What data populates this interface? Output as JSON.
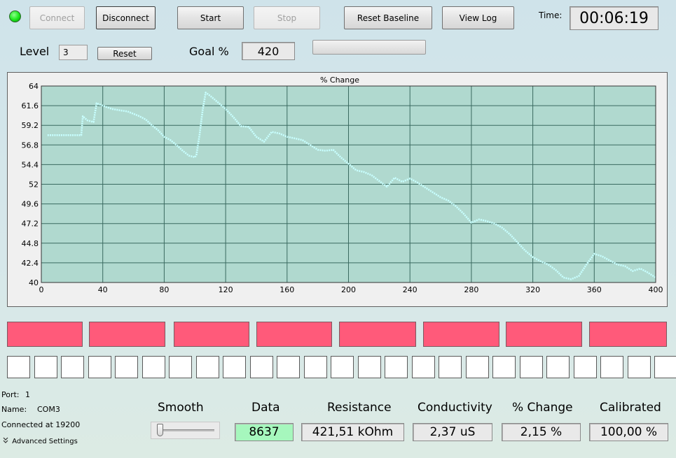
{
  "toolbar": {
    "connect_label": "Connect",
    "disconnect_label": "Disconnect",
    "start_label": "Start",
    "stop_label": "Stop",
    "reset_baseline_label": "Reset Baseline",
    "view_log_label": "View Log",
    "time_label": "Time:",
    "time_value": "00:06:19",
    "status_color": "#19e619"
  },
  "settings": {
    "level_label": "Level",
    "level_value": "3",
    "reset_label": "Reset",
    "goal_label": "Goal %",
    "goal_value": "420",
    "progress": 0
  },
  "chart_data": {
    "type": "line",
    "title": "% Change",
    "xlim": [
      0,
      400
    ],
    "ylim": [
      40,
      64
    ],
    "xticks": [
      0,
      40,
      80,
      120,
      160,
      200,
      240,
      280,
      320,
      360,
      400
    ],
    "yticks": [
      40,
      42.4,
      44.8,
      47.2,
      49.6,
      52,
      54.4,
      56.8,
      59.2,
      61.6,
      64
    ],
    "grid": true,
    "line_color": "#c8ffff",
    "plot_bg": "#b0d9cf",
    "x": [
      4,
      20,
      26,
      27,
      30,
      34,
      36,
      40,
      46,
      52,
      56,
      60,
      64,
      68,
      72,
      76,
      80,
      84,
      88,
      92,
      96,
      100,
      101,
      103,
      105,
      107,
      110,
      115,
      120,
      125,
      130,
      135,
      140,
      145,
      150,
      155,
      160,
      165,
      170,
      175,
      180,
      185,
      190,
      195,
      200,
      205,
      210,
      215,
      220,
      225,
      230,
      235,
      240,
      245,
      250,
      255,
      260,
      265,
      270,
      275,
      280,
      285,
      290,
      295,
      300,
      305,
      310,
      315,
      320,
      325,
      330,
      335,
      340,
      345,
      350,
      355,
      360,
      365,
      370,
      375,
      380,
      385,
      390,
      395,
      400
    ],
    "y": [
      58,
      58,
      58,
      60.3,
      59.8,
      59.6,
      61.9,
      61.6,
      61.2,
      61,
      60.9,
      60.6,
      60.3,
      59.9,
      59.2,
      58.6,
      57.8,
      57.4,
      56.8,
      56.1,
      55.5,
      55.3,
      55.6,
      58,
      61,
      63.2,
      62.8,
      62,
      61.2,
      60.2,
      59.1,
      59,
      57.8,
      57.2,
      58.4,
      58.2,
      57.8,
      57.6,
      57.4,
      56.8,
      56.2,
      56.1,
      56.2,
      55.3,
      54.5,
      53.7,
      53.5,
      53.1,
      52.4,
      51.7,
      52.8,
      52.3,
      52.7,
      52.2,
      51.6,
      51,
      50.4,
      50,
      49.3,
      48.4,
      47.3,
      47.7,
      47.5,
      47.2,
      46.7,
      45.9,
      44.9,
      43.9,
      43.1,
      42.6,
      42.2,
      41.5,
      40.6,
      40.4,
      40.8,
      42.2,
      43.5,
      43.2,
      42.7,
      42.2,
      42,
      41.4,
      41.7,
      41.2,
      40.6
    ]
  },
  "indicators": {
    "red_color": "#ff5a7a",
    "red_count": 8,
    "white_count": 25
  },
  "connection": {
    "port_label": "Port:",
    "port_value": "1",
    "name_label": "Name:",
    "name_value": "COM3",
    "connected_text": "Connected at 19200",
    "advanced_label": "Advanced Settings"
  },
  "readouts": {
    "smooth_label": "Smooth",
    "smooth_value": 0,
    "data_label": "Data",
    "data_value": "8637",
    "data_color": "#a6f7bd",
    "resistance_label": "Resistance",
    "resistance_value": "421,51 kOhm",
    "conductivity_label": "Conductivity",
    "conductivity_value": "2,37 uS",
    "change_label": "% Change",
    "change_value": "2,15 %",
    "calibrated_label": "Calibrated",
    "calibrated_value": "100,00 %"
  }
}
